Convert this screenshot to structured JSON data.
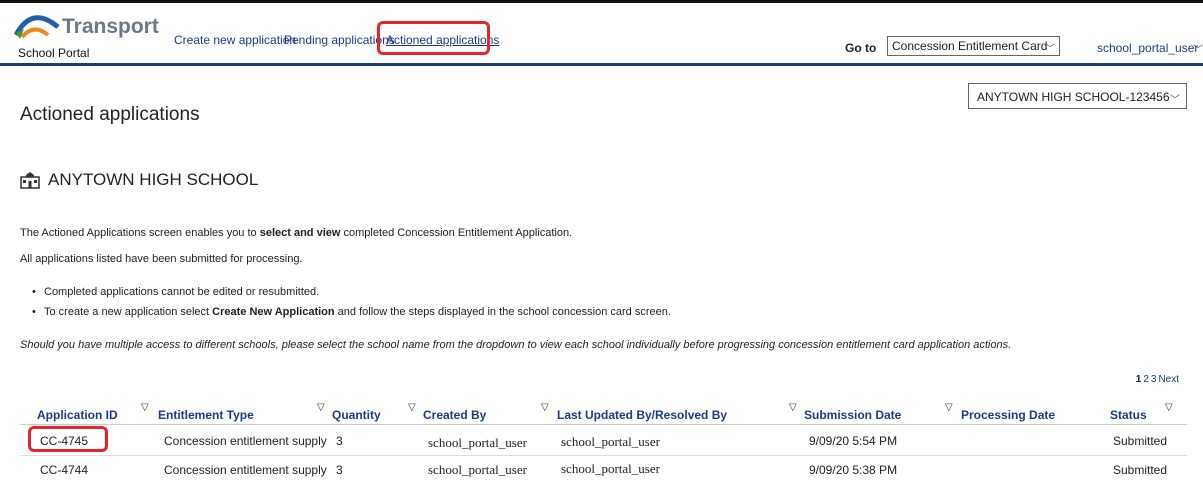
{
  "header": {
    "brand": "Transport",
    "portal": "School Portal",
    "nav": [
      {
        "label": "Create new application"
      },
      {
        "label": "Pending applications"
      },
      {
        "label": "Actioned applications"
      }
    ],
    "goto_label": "Go to",
    "goto_value": "Concession Entitlement Card",
    "user": "school_portal_user"
  },
  "school_select": "ANYTOWN HIGH SCHOOL-123456",
  "page_title": "Actioned applications",
  "school_name": "ANYTOWN HIGH SCHOOL",
  "intro": {
    "part1": "The Actioned Applications screen enables you to ",
    "bold": "select and view",
    "part2": " completed Concession Entitlement Application."
  },
  "intro2": "All applications listed have been submitted for processing.",
  "bullets": {
    "b1": "Completed applications cannot be edited or resubmitted.",
    "b2_part1": "To create a new application select ",
    "b2_bold": "Create New Application",
    "b2_part2": " and follow the steps displayed in the school concession card screen."
  },
  "note": "Should you have multiple access to different schools, please select the school name from the dropdown to view each school individually before progressing concession entitlement card application actions.",
  "pager": {
    "p1": "1",
    "p2": "2",
    "p3": "3",
    "next": "Next"
  },
  "table": {
    "headers": [
      "Application ID",
      "Entitlement Type",
      "Quantity",
      "Created By",
      "Last Updated By/Resolved By",
      "Submission Date",
      "Processing Date",
      "Status"
    ],
    "rows": [
      [
        "CC-4745",
        "Concession entitlement supply",
        "3",
        "school_portal_user",
        "school_portal_user",
        "9/09/20 5:54 PM",
        "",
        "Submitted"
      ],
      [
        "CC-4744",
        "Concession entitlement supply",
        "3",
        "school_portal_user",
        "school_portal_user",
        "9/09/20 5:38 PM",
        "",
        "Submitted"
      ]
    ]
  }
}
